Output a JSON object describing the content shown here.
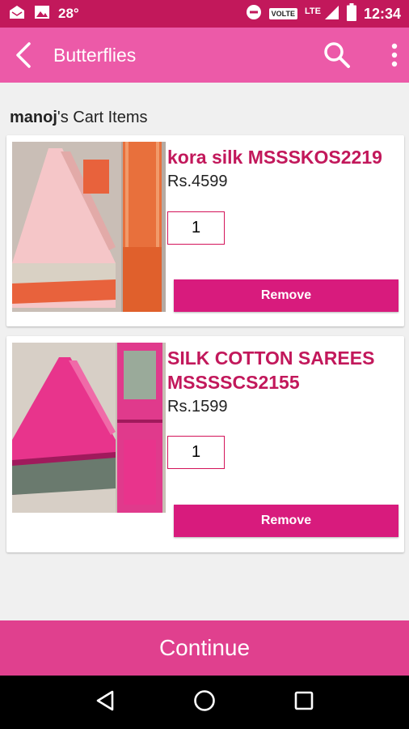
{
  "status_bar": {
    "temperature": "28°",
    "volte": "VOLTE",
    "network": "LTE",
    "time": "12:34"
  },
  "app_bar": {
    "title": "Butterflies",
    "icons": [
      "back-arrow-icon",
      "search-icon",
      "more-vert-icon"
    ]
  },
  "cart": {
    "owner": "manoj",
    "heading_suffix": "'s Cart Items",
    "items": [
      {
        "name": "kora silk MSSSKOS2219",
        "price": "Rs.4599",
        "quantity": "1",
        "remove_label": "Remove",
        "colors": {
          "saree": "#f5c6c8",
          "border": "#e8623c"
        }
      },
      {
        "name": "SILK COTTON SAREES MSSSSCS2155",
        "price": "Rs.1599",
        "quantity": "1",
        "remove_label": "Remove",
        "colors": {
          "saree": "#e8348c",
          "border": "#6a7a6e"
        }
      }
    ]
  },
  "continue_label": "Continue",
  "colors": {
    "status_bar": "#c2185b",
    "app_bar": "#ec5aa8",
    "accent_text": "#c2185b",
    "button": "#d81b7d",
    "continue": "#e0408e"
  },
  "nav_bar": {
    "icons": [
      "back-triangle-icon",
      "home-circle-icon",
      "recents-square-icon"
    ]
  }
}
